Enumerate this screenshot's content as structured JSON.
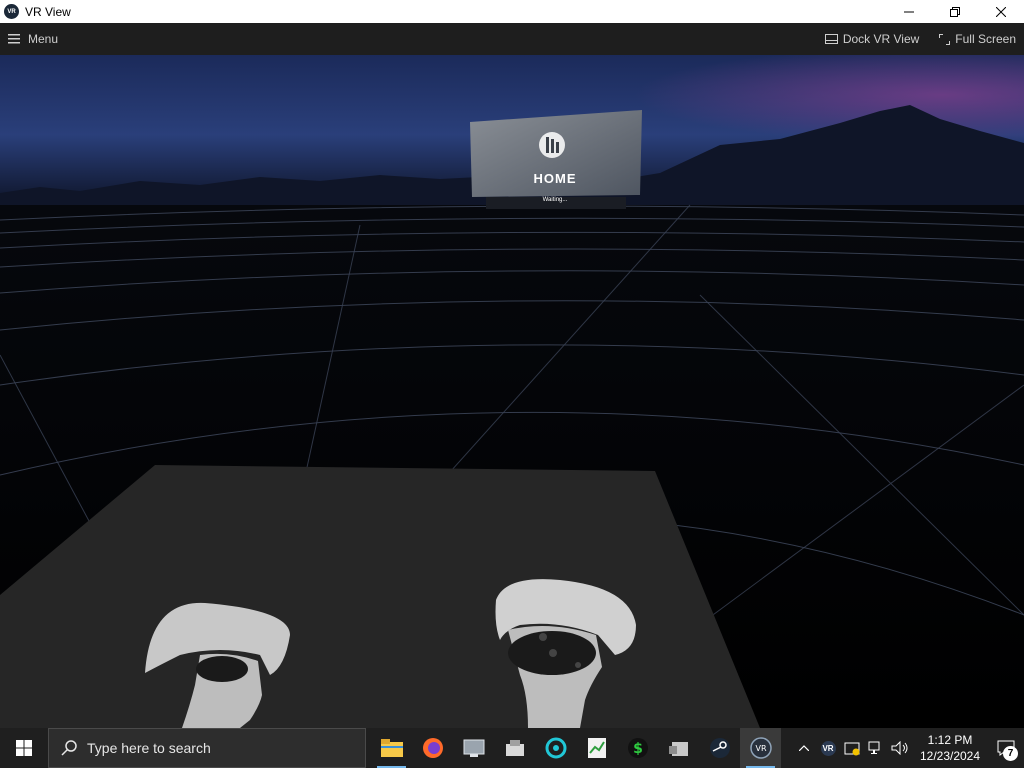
{
  "window": {
    "title": "VR View",
    "app_icon_text": "VR"
  },
  "toolbar": {
    "menu_label": "Menu",
    "dock_label": "Dock VR View",
    "fullscreen_label": "Full Screen"
  },
  "scene": {
    "home_label": "HOME",
    "status_label": "Waiting..."
  },
  "taskbar": {
    "search_placeholder": "Type here to search",
    "apps": [
      "file-explorer-icon",
      "firefox-icon",
      "app-icon",
      "app-icon",
      "app-icon",
      "app-icon",
      "app-icon",
      "app-icon",
      "steam-icon",
      "steamvr-icon"
    ],
    "tray": {
      "vr_label": "VR",
      "time": "1:12 PM",
      "date": "12/23/2024",
      "notification_count": "7"
    }
  },
  "colors": {
    "taskbar": "#1f1f1f",
    "toolbar": "#1e1e1e",
    "accent": "#76b9ed"
  }
}
